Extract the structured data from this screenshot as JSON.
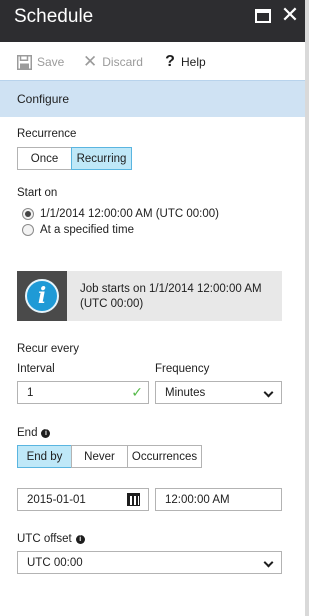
{
  "titlebar": {
    "title": "Schedule"
  },
  "commandbar": {
    "save_label": "Save",
    "discard_label": "Discard",
    "help_label": "Help"
  },
  "configure": {
    "label": "Configure"
  },
  "recurrence": {
    "label": "Recurrence",
    "options": [
      "Once",
      "Recurring"
    ],
    "selected": "Recurring"
  },
  "start_on": {
    "label": "Start on",
    "options": [
      "1/1/2014 12:00:00 AM (UTC 00:00)",
      "At a specified time"
    ],
    "selected": "1/1/2014 12:00:00 AM (UTC 00:00)"
  },
  "info": {
    "text": "Job starts on 1/1/2014 12:00:00 AM (UTC 00:00)"
  },
  "recur_every": {
    "label": "Recur every",
    "interval_label": "Interval",
    "interval_value": "1",
    "frequency_label": "Frequency",
    "frequency_value": "Minutes"
  },
  "end": {
    "label": "End",
    "options": [
      "End by",
      "Never",
      "Occurrences"
    ],
    "selected": "End by",
    "date_value": "2015-01-01",
    "time_value": "12:00:00 AM"
  },
  "utc_offset": {
    "label": "UTC offset",
    "value": "UTC 00:00"
  },
  "colors": {
    "titlebar": "#2d2d30",
    "configure_bg": "#cfe2f3",
    "selected_seg": "#bfe8f8",
    "info_icon": "#1f9ad6",
    "valid_check": "#54b948"
  },
  "icons": {
    "save": "save-icon",
    "discard": "close-icon",
    "help": "help-icon",
    "info": "info-icon",
    "calendar": "calendar-icon",
    "maximize": "maximize-icon",
    "close": "close-icon"
  }
}
